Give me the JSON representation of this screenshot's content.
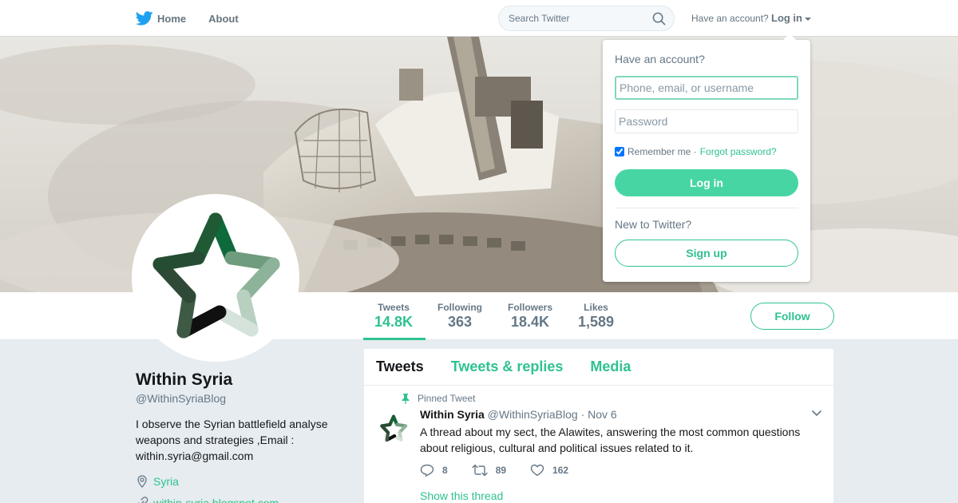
{
  "nav": {
    "home_label": "Home",
    "about_label": "About",
    "search_placeholder": "Search Twitter",
    "have_account": "Have an account?",
    "login_label": "Log in"
  },
  "profile": {
    "name": "Within Syria",
    "handle": "@WithinSyriaBlog",
    "bio": "I observe the Syrian battlefield analyse weapons and strategies ,Email : within.syria@gmail.com",
    "location": "Syria",
    "website": "within-syria.blogspot.com"
  },
  "stats": [
    {
      "label": "Tweets",
      "value": "14.8K"
    },
    {
      "label": "Following",
      "value": "363"
    },
    {
      "label": "Followers",
      "value": "18.4K"
    },
    {
      "label": "Likes",
      "value": "1,589"
    }
  ],
  "follow_label": "Follow",
  "timeline": {
    "tabs": [
      "Tweets",
      "Tweets & replies",
      "Media"
    ],
    "pinned_label": "Pinned Tweet",
    "tweet": {
      "name": "Within Syria",
      "handle": "@WithinSyriaBlog",
      "date": "· Nov 6",
      "text": "A thread about my sect, the Alawites, answering the most common questions about religious, cultural and political issues related to it.",
      "replies": "8",
      "retweets": "89",
      "likes": "162",
      "show_thread": "Show this thread"
    }
  },
  "login_dropdown": {
    "title": "Have an account?",
    "username_placeholder": "Phone, email, or username",
    "password_placeholder": "Password",
    "remember_label": "Remember me ·",
    "forgot_label": "Forgot password?",
    "login_button": "Log in",
    "new_label": "New to Twitter?",
    "signup_button": "Sign up"
  },
  "colors": {
    "accent": "#2fc28f",
    "login_button": "#47d6a3",
    "twitter_blue": "#1da1f2"
  },
  "icons": [
    "twitter-bird-icon",
    "search-icon",
    "caret-down-icon",
    "location-icon",
    "link-icon",
    "pin-icon",
    "reply-icon",
    "retweet-icon",
    "like-icon",
    "chevron-down-icon"
  ]
}
